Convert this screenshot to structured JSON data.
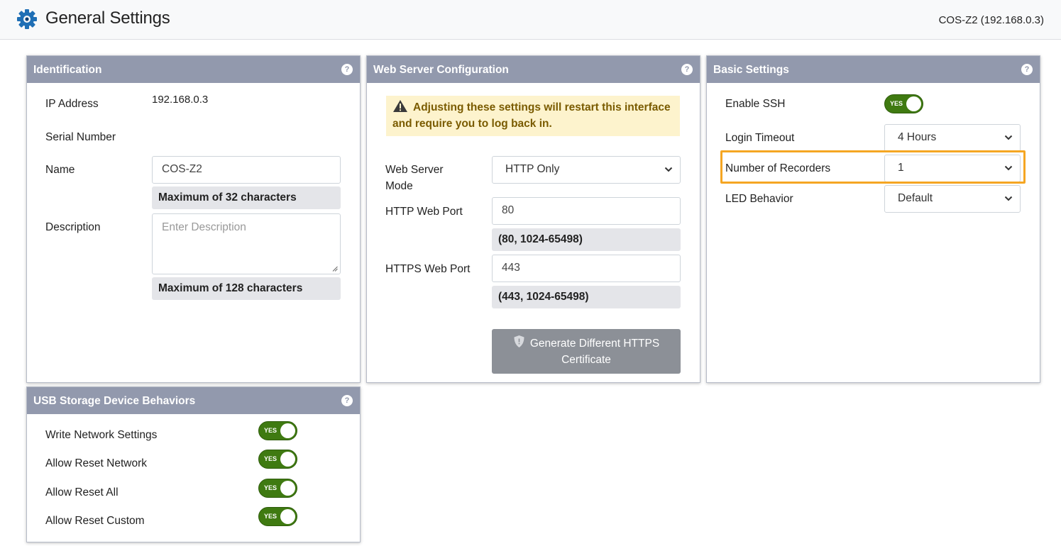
{
  "header": {
    "title": "General Settings",
    "device": "COS-Z2 (192.168.0.3)",
    "icon": "gear-icon"
  },
  "help_symbol": "?",
  "identification": {
    "title": "Identification",
    "ip_label": "IP Address",
    "ip_value": "192.168.0.3",
    "serial_label": "Serial Number",
    "serial_value": "",
    "name_label": "Name",
    "name_value": "COS-Z2",
    "name_hint": "Maximum of 32 characters",
    "description_label": "Description",
    "description_placeholder": "Enter Description",
    "description_value": "",
    "description_hint": "Maximum of 128 characters"
  },
  "webserver": {
    "title": "Web Server Configuration",
    "warning": "Adjusting these settings will restart this interface and require you to log back in.",
    "mode_label_line1": "Web Server",
    "mode_label_line2": "Mode",
    "mode_value": "HTTP Only",
    "http_port_label": "HTTP Web Port",
    "http_port_value": "80",
    "http_port_hint": "(80, 1024-65498)",
    "https_port_label": "HTTPS Web Port",
    "https_port_value": "443",
    "https_port_hint": "(443, 1024-65498)",
    "generate_button_line1": "Generate Different HTTPS",
    "generate_button_line2": "Certificate"
  },
  "basic": {
    "title": "Basic Settings",
    "ssh_label": "Enable SSH",
    "ssh_toggle": "YES",
    "login_timeout_label": "Login Timeout",
    "login_timeout_value": "4 Hours",
    "recorders_label": "Number of Recorders",
    "recorders_value": "1",
    "led_label": "LED Behavior",
    "led_value": "Default"
  },
  "usb": {
    "title": "USB Storage Device Behaviors",
    "items": [
      {
        "label": "Write Network Settings",
        "toggle": "YES"
      },
      {
        "label": "Allow Reset Network",
        "toggle": "YES"
      },
      {
        "label": "Allow Reset All",
        "toggle": "YES"
      },
      {
        "label": "Allow Reset Custom",
        "toggle": "YES"
      }
    ]
  },
  "colors": {
    "card_header": "#9299ad",
    "toggle_on": "#3f7a11",
    "highlight": "#f5a623",
    "warning_bg": "#fdf3cd",
    "header_icon": "#1f6fb5"
  }
}
